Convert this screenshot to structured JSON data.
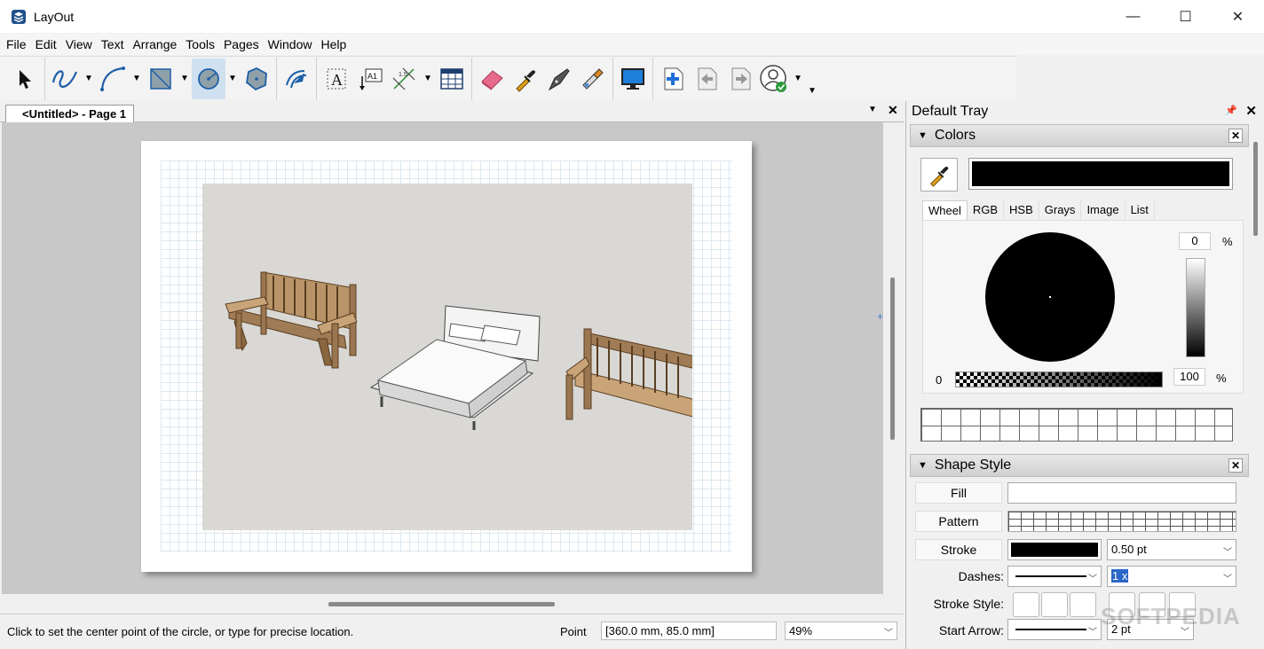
{
  "window": {
    "title": "LayOut",
    "minimize": "—",
    "maximize": "☐",
    "close": "✕"
  },
  "menu": [
    "File",
    "Edit",
    "View",
    "Text",
    "Arrange",
    "Tools",
    "Pages",
    "Window",
    "Help"
  ],
  "document": {
    "tab_label": "<Untitled> - Page 1"
  },
  "status": {
    "message": "Click to set the center point of the circle, or type for precise location.",
    "measure_label": "Point",
    "coords": "[360.0 mm, 85.0 mm]",
    "zoom": "49%"
  },
  "tray": {
    "title": "Default Tray",
    "colors": {
      "title": "Colors",
      "tabs": [
        "Wheel",
        "RGB",
        "HSB",
        "Grays",
        "Image",
        "List"
      ],
      "selected_tab": "Wheel",
      "brightness_value": "0",
      "opacity_value": "100",
      "opacity_min_label": "0",
      "percent": "%",
      "current_color": "#000000"
    },
    "shape_style": {
      "title": "Shape Style",
      "fill_label": "Fill",
      "pattern_label": "Pattern",
      "stroke_label": "Stroke",
      "stroke_width": "0.50 pt",
      "dashes_label": "Dashes:",
      "dash_scale": "1 x",
      "stroke_style_label": "Stroke Style:",
      "start_arrow_label": "Start Arrow:",
      "start_arrow_size": "2 pt"
    }
  },
  "watermark": "SOFTPEDIA"
}
